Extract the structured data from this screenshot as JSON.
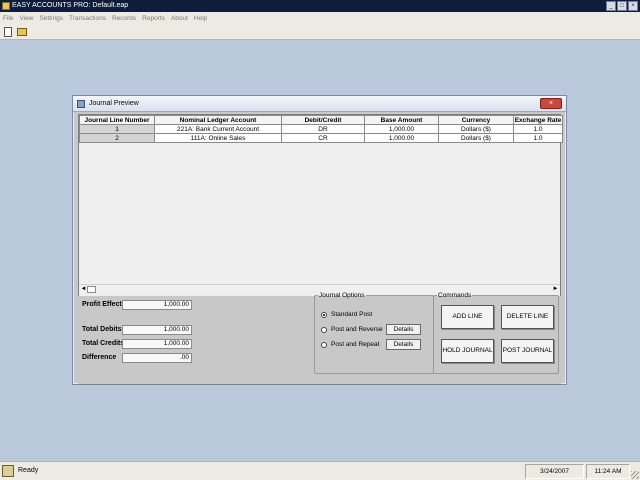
{
  "app": {
    "title": "EASY ACCOUNTS PRO: Default.eap",
    "window_buttons": [
      "_",
      "□",
      "×"
    ]
  },
  "menu": [
    "File",
    "View",
    "Settings",
    "Transactions",
    "Records",
    "Reports",
    "About",
    "Help"
  ],
  "toolbar": {
    "icons": [
      "new-file-icon",
      "open-folder-icon"
    ]
  },
  "dialog": {
    "title": "Journal Preview",
    "close_label": "×",
    "columns": [
      "Journal Line Number",
      "Nominal Ledger Account",
      "Debit/Credit",
      "Base Amount",
      "Currency",
      "Exchange Rate"
    ],
    "rows": [
      [
        "1",
        "221A: Bank Current Account",
        "DR",
        "1,000.00",
        "Dollars ($)",
        "1.0"
      ],
      [
        "2",
        "111A: Online Sales",
        "CR",
        "1,000.00",
        "Dollars ($)",
        "1.0"
      ]
    ],
    "summary": {
      "profit_effect_label": "Profit Effect",
      "profit_effect_value": "1,000.00",
      "total_debits_label": "Total Debits",
      "total_debits_value": "1,000.00",
      "total_credits_label": "Total Credits",
      "total_credits_value": "1,000.00",
      "difference_label": "Difference",
      "difference_value": ".00"
    },
    "journal_options": {
      "legend": "Journal Options",
      "standard_post": "Standard Post",
      "post_and_reverse": "Post and Reverse",
      "post_and_repeat": "Post and Repeat",
      "details_label": "Details",
      "selected": "standard_post"
    },
    "commands": {
      "legend": "Commands",
      "add_line": "ADD LINE",
      "delete_line": "DELETE LINE",
      "hold_journal": "HOLD JOURNAL",
      "post_journal": "POST JOURNAL"
    }
  },
  "status": {
    "text": "Ready",
    "date": "3/24/2007",
    "time": "11:24 AM"
  }
}
